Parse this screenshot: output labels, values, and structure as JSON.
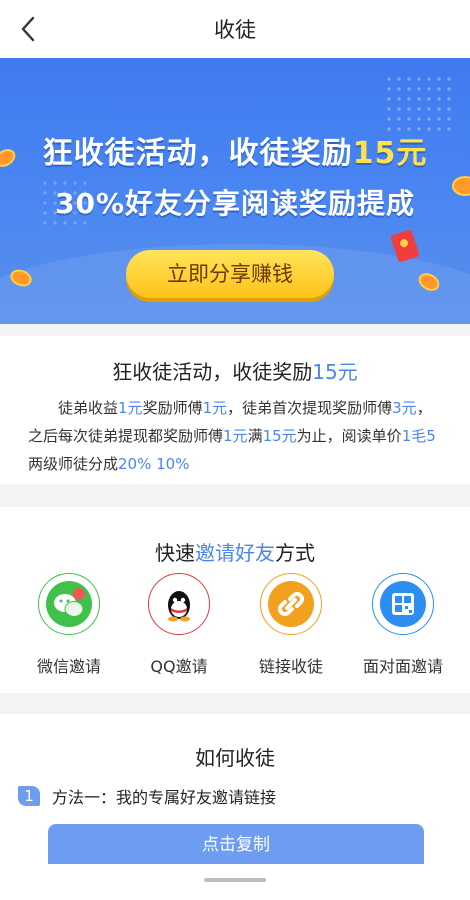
{
  "header": {
    "title": "收徒"
  },
  "banner": {
    "line1_prefix": "狂收徒活动，收徒奖励",
    "line1_amount": "15元",
    "line2": "30%好友分享阅读奖励提成",
    "cta_label": "立即分享赚钱"
  },
  "activity": {
    "title_prefix": "狂收徒活动，收徒奖励",
    "title_amount": "15元",
    "desc": [
      {
        "t": "徒弟收益",
        "hl": false
      },
      {
        "t": "1元",
        "hl": true
      },
      {
        "t": "奖励师傅",
        "hl": false
      },
      {
        "t": "1元",
        "hl": true
      },
      {
        "t": "，徒弟首次提现奖励师傅",
        "hl": false
      },
      {
        "t": "3元",
        "hl": true
      },
      {
        "t": "，之后每次徒弟提现都奖励师傅",
        "hl": false
      },
      {
        "t": "1元",
        "hl": true
      },
      {
        "t": "满",
        "hl": false
      },
      {
        "t": "15元",
        "hl": true
      },
      {
        "t": "为止，阅读单价",
        "hl": false
      },
      {
        "t": "1毛5",
        "hl": true
      },
      {
        "t": " 两级师徒分成",
        "hl": false
      },
      {
        "t": "20% 10%",
        "hl": true
      }
    ]
  },
  "invite": {
    "title_prefix": "快速",
    "title_hl": "邀请好友",
    "title_suffix": "方式",
    "options": [
      {
        "label": "微信邀请",
        "icon": "wechat-icon",
        "color": "#3fc14a"
      },
      {
        "label": "QQ邀请",
        "icon": "qq-icon",
        "color": "#e23b3b"
      },
      {
        "label": "链接收徒",
        "icon": "link-icon",
        "color": "#f2a11f"
      },
      {
        "label": "面对面邀请",
        "icon": "qrcode-icon",
        "color": "#2b8ef0"
      }
    ]
  },
  "howto": {
    "title": "如何收徒",
    "step_number": "1",
    "step_text": "方法一：我的专属好友邀请链接",
    "copy_label": "点击复制"
  },
  "colors": {
    "accent": "#4a86f0",
    "button": "#6d9cf0",
    "cta": "#ffc21a"
  }
}
